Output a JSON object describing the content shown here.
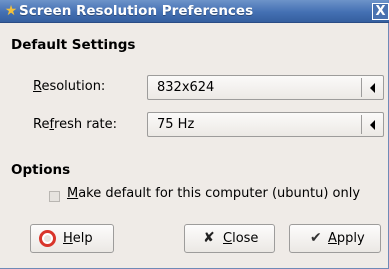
{
  "window": {
    "title": "Screen Resolution Preferences",
    "title_icon": "star-icon",
    "close_glyph": "X"
  },
  "default_settings": {
    "heading": "Default Settings",
    "resolution": {
      "label_first": "R",
      "label_rest": "esolution:",
      "value": "832x624"
    },
    "refresh_rate": {
      "label_first": "Re",
      "label_u": "f",
      "label_rest": "resh rate:",
      "value": "75 Hz"
    }
  },
  "options": {
    "heading": "Options",
    "make_default": {
      "checked": false,
      "label_u": "M",
      "label_rest": "ake default for this computer (ubuntu) only"
    }
  },
  "buttons": {
    "help": {
      "u": "H",
      "rest": "elp",
      "icon": "help-lifebuoy-icon"
    },
    "close": {
      "u": "C",
      "rest": "lose",
      "icon": "close-x-icon",
      "glyph": "✘"
    },
    "apply": {
      "u": "A",
      "rest": "pply",
      "icon": "checkmark-icon",
      "glyph": "✔"
    }
  },
  "colors": {
    "titlebar": "#4470b3",
    "title_icon": "#f3c03b",
    "help_icon": "#d9352b",
    "window_bg": "#efebe7"
  }
}
